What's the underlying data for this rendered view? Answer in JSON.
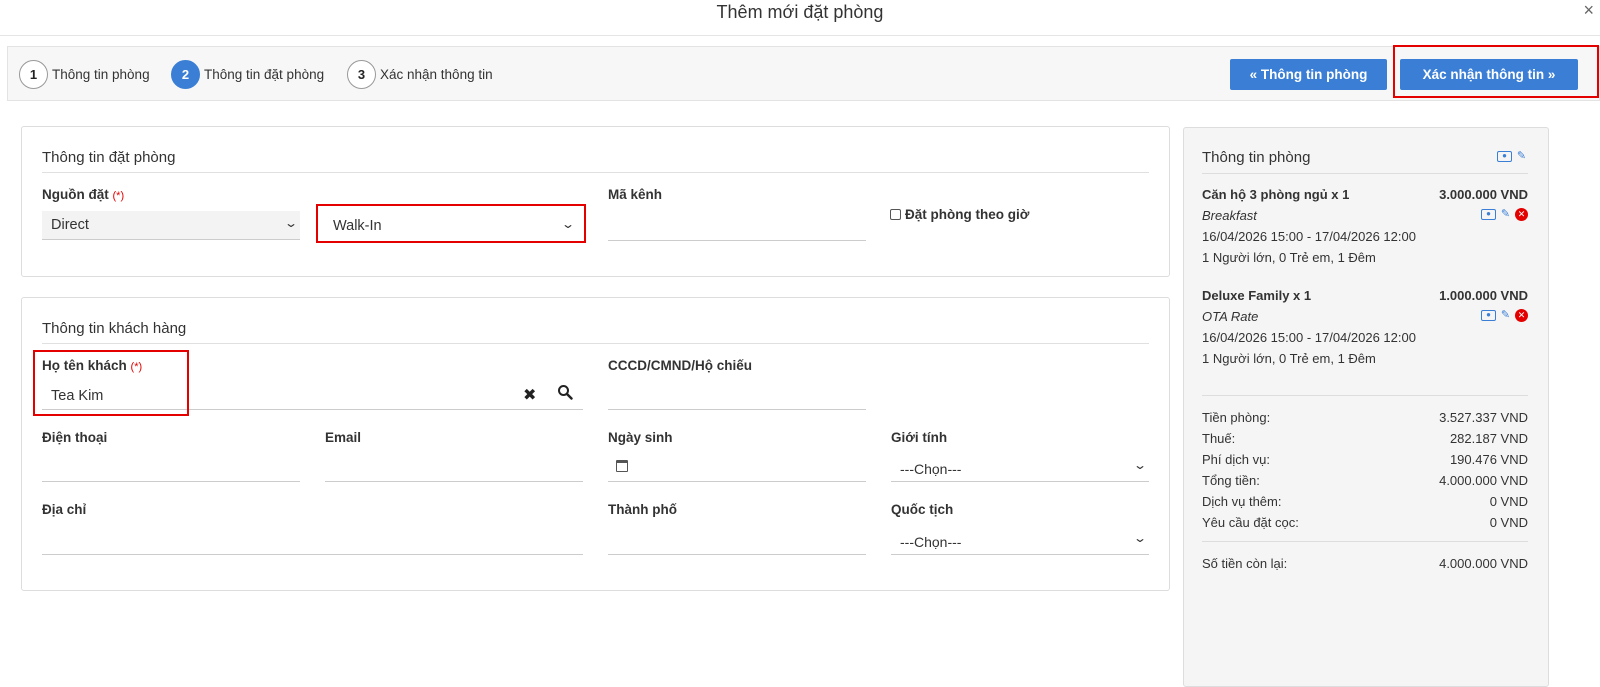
{
  "modal": {
    "title": "Thêm mới đặt phòng",
    "close": "×"
  },
  "steps": [
    {
      "num": "1",
      "label": "Thông tin phòng"
    },
    {
      "num": "2",
      "label": "Thông tin đặt phòng"
    },
    {
      "num": "3",
      "label": "Xác nhận thông tin"
    }
  ],
  "buttons": {
    "prev": "« Thông tin phòng",
    "next": "Xác nhận thông tin »"
  },
  "booking": {
    "title": "Thông tin đặt phòng",
    "source_label": "Nguồn đặt",
    "required_mark": "(*)",
    "source_value": "Direct",
    "subsource_value": "Walk-In",
    "channel_label": "Mã kênh",
    "hourly_label": "Đặt phòng theo giờ"
  },
  "customer": {
    "title": "Thông tin khách hàng",
    "name_label": "Họ tên khách",
    "required_mark": "(*)",
    "name_value": "Tea Kim",
    "id_label": "CCCD/CMND/Hộ chiếu",
    "phone_label": "Điện thoại",
    "email_label": "Email",
    "dob_label": "Ngày sinh",
    "gender_label": "Giới tính",
    "gender_value": "---Chọn---",
    "address_label": "Địa chỉ",
    "city_label": "Thành phố",
    "nationality_label": "Quốc tịch",
    "nationality_value": "---Chọn---"
  },
  "summary": {
    "title": "Thông tin phòng",
    "rooms": [
      {
        "name": "Căn hộ 3 phòng ngủ x 1",
        "price": "3.000.000 VND",
        "rate": "Breakfast",
        "dates": "16/04/2026 15:00 - 17/04/2026 12:00",
        "guests": "1 Người lớn, 0 Trẻ em, 1 Đêm"
      },
      {
        "name": "Deluxe Family x 1",
        "price": "1.000.000 VND",
        "rate": "OTA Rate",
        "dates": "16/04/2026 15:00 - 17/04/2026 12:00",
        "guests": "1 Người lớn, 0 Trẻ em, 1 Đêm"
      }
    ],
    "totals": [
      {
        "label": "Tiền phòng:",
        "value": "3.527.337 VND"
      },
      {
        "label": "Thuế:",
        "value": "282.187 VND"
      },
      {
        "label": "Phí dịch vụ:",
        "value": "190.476 VND"
      },
      {
        "label": "Tổng tiền:",
        "value": "4.000.000 VND"
      },
      {
        "label": "Dịch vụ thêm:",
        "value": "0 VND"
      },
      {
        "label": "Yêu cầu đặt cọc:",
        "value": "0 VND"
      }
    ],
    "remaining_label": "Số tiền còn lại:",
    "remaining_value": "4.000.000 VND"
  },
  "colors": {
    "primary": "#3a7fd5",
    "highlight": "#e50000"
  }
}
